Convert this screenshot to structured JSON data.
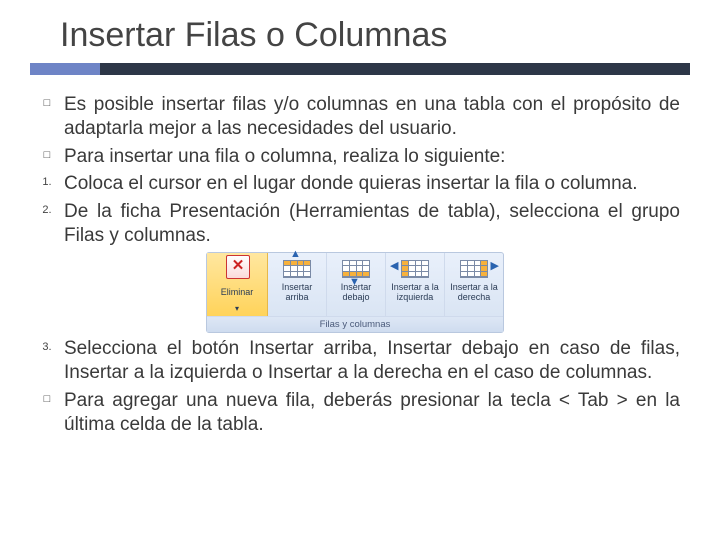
{
  "title": "Insertar Filas o Columnas",
  "bullets": [
    {
      "marker": "□",
      "text": "Es posible insertar filas y/o columnas en una tabla con el propósito de adaptarla mejor a las necesidades del usuario."
    },
    {
      "marker": "□",
      "text": "Para insertar una fila o columna, realiza lo siguiente:"
    },
    {
      "marker": "1.",
      "text": "Coloca el cursor en el lugar donde quieras insertar la fila o columna."
    },
    {
      "marker": "2.",
      "text": "De la ficha Presentación (Herramientas de tabla), selecciona el grupo Filas y columnas."
    },
    {
      "marker": "3.",
      "text": "Selecciona el botón Insertar arriba, Insertar debajo en caso de filas, Insertar a la izquierda o Insertar a la derecha en el caso de columnas."
    },
    {
      "marker": "□",
      "text": "Para agregar una nueva fila, deberás presionar la tecla < Tab > en la última celda de la tabla."
    }
  ],
  "ribbon": {
    "group_caption": "Filas y columnas",
    "buttons": [
      {
        "id": "delete",
        "label": "Eliminar",
        "active": true
      },
      {
        "id": "insert-above",
        "label": "Insertar arriba"
      },
      {
        "id": "insert-below",
        "label": "Insertar debajo"
      },
      {
        "id": "insert-left",
        "label": "Insertar a la izquierda"
      },
      {
        "id": "insert-right",
        "label": "Insertar a la derecha"
      }
    ]
  }
}
